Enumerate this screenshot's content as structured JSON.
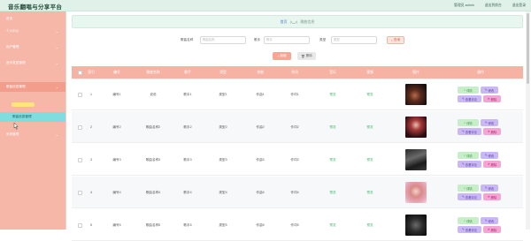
{
  "app": {
    "title": "音乐翻唱与分享平台"
  },
  "topbar": {
    "links": [
      "管理员 admin",
      "退出到前台",
      "退出登录"
    ]
  },
  "sidebar": {
    "items": [
      {
        "label": "首页",
        "arrow": "",
        "state": "normal"
      },
      {
        "label": "个人中心",
        "arrow": "⌄",
        "state": "normal"
      },
      {
        "label": "用户管理",
        "arrow": "⌄",
        "state": "normal"
      },
      {
        "label": "音乐类型管理",
        "arrow": "⌄",
        "state": "normal"
      },
      {
        "label": "歌曲信息管理",
        "arrow": "⌄",
        "state": "normal"
      },
      {
        "label": "歌曲信息管理",
        "arrow": "",
        "state": "active"
      },
      {
        "label": "系统管理",
        "arrow": "⌄",
        "state": "normal"
      }
    ]
  },
  "breadcrumb": {
    "home": "首页",
    "separator": "(•‿•)",
    "current": "歌曲信息"
  },
  "search": {
    "label1": "歌曲名称",
    "placeholder1": "歌曲名称",
    "label2": "歌手",
    "placeholder2": "歌手",
    "label3": "类型",
    "placeholder3": "类型",
    "query_label": "查询"
  },
  "toolbar": {
    "add_label": "新增",
    "delete_label": "删除"
  },
  "table": {
    "headers": [
      "索引",
      "编号",
      "歌曲名称",
      "歌手",
      "类型",
      "作曲",
      "作词",
      "音乐",
      "视频",
      "图片",
      "操作"
    ],
    "rows": [
      {
        "index": "1",
        "code": "编号1",
        "name": "说说",
        "singer": "歌手1",
        "type": "类型1",
        "composer": "作曲1",
        "lyricist": "作词1",
        "music": "预览",
        "video": "预览"
      },
      {
        "index": "2",
        "code": "编号2",
        "name": "歌曲名称2",
        "singer": "歌手2",
        "type": "类型2",
        "composer": "作曲2",
        "lyricist": "作词2",
        "music": "预览",
        "video": "预览"
      },
      {
        "index": "3",
        "code": "编号3",
        "name": "歌曲名称3",
        "singer": "歌手3",
        "type": "类型3",
        "composer": "作曲3",
        "lyricist": "作词3",
        "music": "预览",
        "video": "预览"
      },
      {
        "index": "4",
        "code": "编号4",
        "name": "歌曲名称4",
        "singer": "歌手4",
        "type": "类型4",
        "composer": "作曲4",
        "lyricist": "作词4",
        "music": "预览",
        "video": "预览"
      },
      {
        "index": "5",
        "code": "编号5",
        "name": "歌曲名称5",
        "singer": "歌手5",
        "type": "类型5",
        "composer": "作曲5",
        "lyricist": "作词5",
        "music": "预览",
        "video": "预览"
      }
    ],
    "ops": {
      "detail": "详情",
      "edit": "修改",
      "comment": "查看评论",
      "delete": "删除"
    }
  },
  "colors": {
    "accent": "#f6b3a3",
    "active": "#7fdde0",
    "topbar": "#dff1e9"
  }
}
